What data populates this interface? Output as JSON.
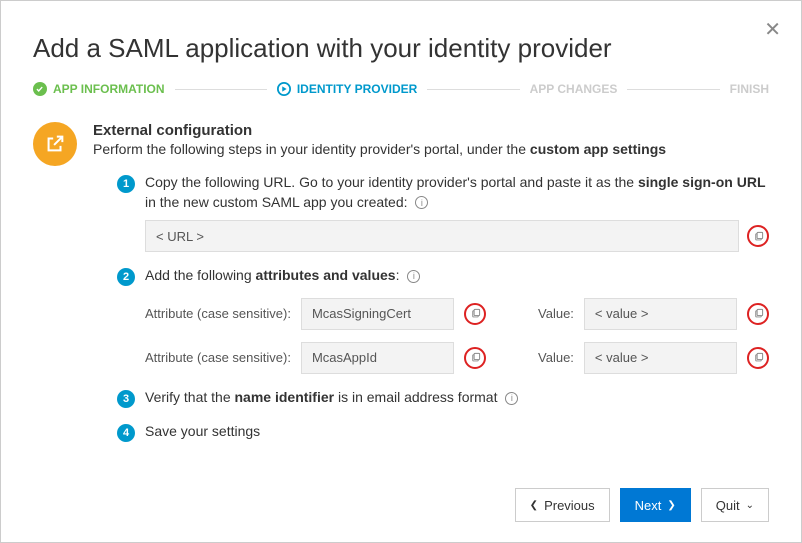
{
  "title": "Add a SAML application with your identity provider",
  "stepper": {
    "steps": [
      "APP INFORMATION",
      "IDENTITY PROVIDER",
      "APP CHANGES",
      "FINISH"
    ]
  },
  "section": {
    "title": "External configuration",
    "subtitle_prefix": "Perform the following steps in your identity provider's portal, under the ",
    "subtitle_bold": "custom app settings"
  },
  "step1": {
    "text_a": "Copy the following URL. Go to your identity provider's portal and paste it as the ",
    "text_bold": "single sign-on URL",
    "text_b": " in the new custom SAML app you created:",
    "url_value": "< URL >"
  },
  "step2": {
    "text_a": "Add the following ",
    "text_bold": "attributes and values",
    "text_b": ":",
    "attr_label": "Attribute (case sensitive):",
    "value_label": "Value:",
    "rows": [
      {
        "attr": "McasSigningCert",
        "value": "< value >"
      },
      {
        "attr": "McasAppId",
        "value": "< value >"
      }
    ]
  },
  "step3": {
    "text_a": "Verify that the ",
    "text_bold": "name identifier",
    "text_b": " is in email address format"
  },
  "step4": {
    "text": "Save your settings"
  },
  "buttons": {
    "previous": "Previous",
    "next": "Next",
    "quit": "Quit"
  }
}
